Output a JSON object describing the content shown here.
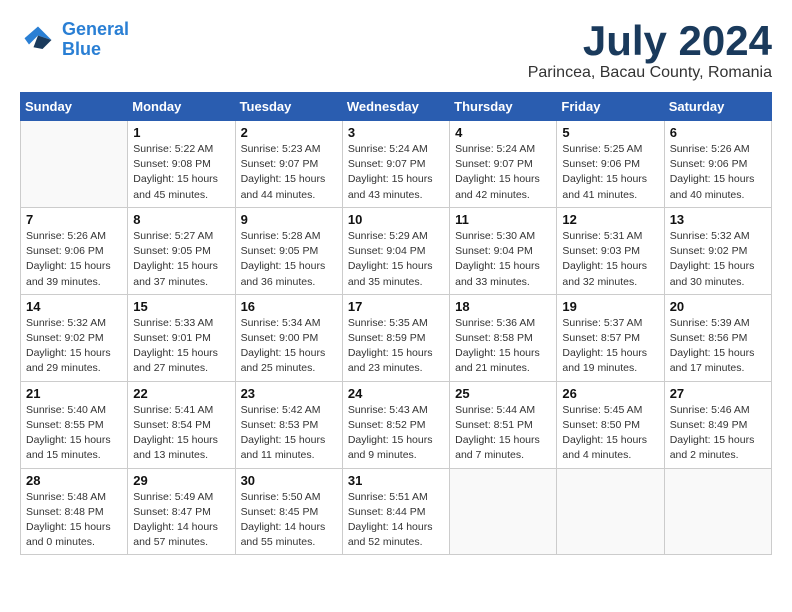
{
  "header": {
    "logo_line1": "General",
    "logo_line2": "Blue",
    "month": "July 2024",
    "location": "Parincea, Bacau County, Romania"
  },
  "weekdays": [
    "Sunday",
    "Monday",
    "Tuesday",
    "Wednesday",
    "Thursday",
    "Friday",
    "Saturday"
  ],
  "weeks": [
    [
      {
        "day": "",
        "info": ""
      },
      {
        "day": "1",
        "info": "Sunrise: 5:22 AM\nSunset: 9:08 PM\nDaylight: 15 hours\nand 45 minutes."
      },
      {
        "day": "2",
        "info": "Sunrise: 5:23 AM\nSunset: 9:07 PM\nDaylight: 15 hours\nand 44 minutes."
      },
      {
        "day": "3",
        "info": "Sunrise: 5:24 AM\nSunset: 9:07 PM\nDaylight: 15 hours\nand 43 minutes."
      },
      {
        "day": "4",
        "info": "Sunrise: 5:24 AM\nSunset: 9:07 PM\nDaylight: 15 hours\nand 42 minutes."
      },
      {
        "day": "5",
        "info": "Sunrise: 5:25 AM\nSunset: 9:06 PM\nDaylight: 15 hours\nand 41 minutes."
      },
      {
        "day": "6",
        "info": "Sunrise: 5:26 AM\nSunset: 9:06 PM\nDaylight: 15 hours\nand 40 minutes."
      }
    ],
    [
      {
        "day": "7",
        "info": "Sunrise: 5:26 AM\nSunset: 9:06 PM\nDaylight: 15 hours\nand 39 minutes."
      },
      {
        "day": "8",
        "info": "Sunrise: 5:27 AM\nSunset: 9:05 PM\nDaylight: 15 hours\nand 37 minutes."
      },
      {
        "day": "9",
        "info": "Sunrise: 5:28 AM\nSunset: 9:05 PM\nDaylight: 15 hours\nand 36 minutes."
      },
      {
        "day": "10",
        "info": "Sunrise: 5:29 AM\nSunset: 9:04 PM\nDaylight: 15 hours\nand 35 minutes."
      },
      {
        "day": "11",
        "info": "Sunrise: 5:30 AM\nSunset: 9:04 PM\nDaylight: 15 hours\nand 33 minutes."
      },
      {
        "day": "12",
        "info": "Sunrise: 5:31 AM\nSunset: 9:03 PM\nDaylight: 15 hours\nand 32 minutes."
      },
      {
        "day": "13",
        "info": "Sunrise: 5:32 AM\nSunset: 9:02 PM\nDaylight: 15 hours\nand 30 minutes."
      }
    ],
    [
      {
        "day": "14",
        "info": "Sunrise: 5:32 AM\nSunset: 9:02 PM\nDaylight: 15 hours\nand 29 minutes."
      },
      {
        "day": "15",
        "info": "Sunrise: 5:33 AM\nSunset: 9:01 PM\nDaylight: 15 hours\nand 27 minutes."
      },
      {
        "day": "16",
        "info": "Sunrise: 5:34 AM\nSunset: 9:00 PM\nDaylight: 15 hours\nand 25 minutes."
      },
      {
        "day": "17",
        "info": "Sunrise: 5:35 AM\nSunset: 8:59 PM\nDaylight: 15 hours\nand 23 minutes."
      },
      {
        "day": "18",
        "info": "Sunrise: 5:36 AM\nSunset: 8:58 PM\nDaylight: 15 hours\nand 21 minutes."
      },
      {
        "day": "19",
        "info": "Sunrise: 5:37 AM\nSunset: 8:57 PM\nDaylight: 15 hours\nand 19 minutes."
      },
      {
        "day": "20",
        "info": "Sunrise: 5:39 AM\nSunset: 8:56 PM\nDaylight: 15 hours\nand 17 minutes."
      }
    ],
    [
      {
        "day": "21",
        "info": "Sunrise: 5:40 AM\nSunset: 8:55 PM\nDaylight: 15 hours\nand 15 minutes."
      },
      {
        "day": "22",
        "info": "Sunrise: 5:41 AM\nSunset: 8:54 PM\nDaylight: 15 hours\nand 13 minutes."
      },
      {
        "day": "23",
        "info": "Sunrise: 5:42 AM\nSunset: 8:53 PM\nDaylight: 15 hours\nand 11 minutes."
      },
      {
        "day": "24",
        "info": "Sunrise: 5:43 AM\nSunset: 8:52 PM\nDaylight: 15 hours\nand 9 minutes."
      },
      {
        "day": "25",
        "info": "Sunrise: 5:44 AM\nSunset: 8:51 PM\nDaylight: 15 hours\nand 7 minutes."
      },
      {
        "day": "26",
        "info": "Sunrise: 5:45 AM\nSunset: 8:50 PM\nDaylight: 15 hours\nand 4 minutes."
      },
      {
        "day": "27",
        "info": "Sunrise: 5:46 AM\nSunset: 8:49 PM\nDaylight: 15 hours\nand 2 minutes."
      }
    ],
    [
      {
        "day": "28",
        "info": "Sunrise: 5:48 AM\nSunset: 8:48 PM\nDaylight: 15 hours\nand 0 minutes."
      },
      {
        "day": "29",
        "info": "Sunrise: 5:49 AM\nSunset: 8:47 PM\nDaylight: 14 hours\nand 57 minutes."
      },
      {
        "day": "30",
        "info": "Sunrise: 5:50 AM\nSunset: 8:45 PM\nDaylight: 14 hours\nand 55 minutes."
      },
      {
        "day": "31",
        "info": "Sunrise: 5:51 AM\nSunset: 8:44 PM\nDaylight: 14 hours\nand 52 minutes."
      },
      {
        "day": "",
        "info": ""
      },
      {
        "day": "",
        "info": ""
      },
      {
        "day": "",
        "info": ""
      }
    ]
  ]
}
